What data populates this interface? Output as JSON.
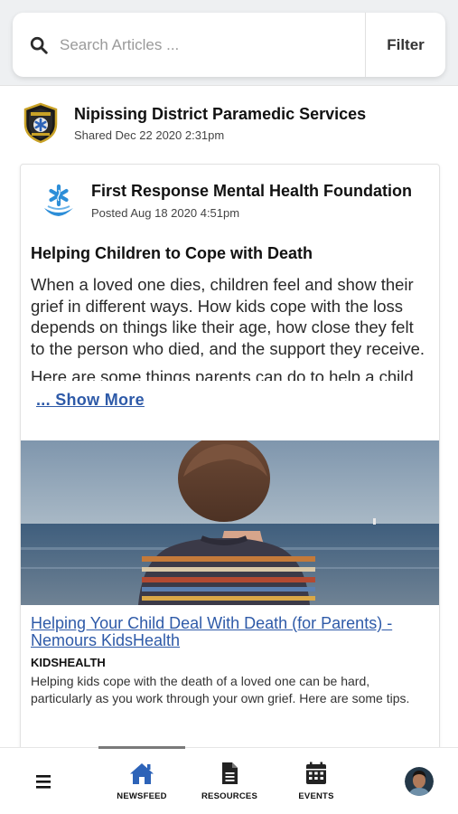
{
  "search": {
    "placeholder": "Search Articles ...",
    "filter_label": "Filter"
  },
  "share": {
    "org_name": "Nipissing District Paramedic Services",
    "shared_date": "Shared Dec 22 2020 2:31pm",
    "logo_icon": "paramedic-badge-icon"
  },
  "post": {
    "author": "First Response Mental Health Foundation",
    "posted_date": "Posted Aug 18 2020 4:51pm",
    "logo_icon": "star-of-life-icon",
    "title": "Helping Children to Cope with Death",
    "body_paragraphs": [
      "When a loved one dies, children feel and show their grief in different ways. How kids cope with the loss depends on things like their age, how close they felt to the person who died, and the support they receive.",
      "Here are some things parents can do to help a child deal with a loss:"
    ],
    "show_more": "... Show More"
  },
  "link_preview": {
    "title": "Helping Your Child Deal With Death (for Parents) - Nemours KidsHealth",
    "source": "KIDSHEALTH",
    "description": "Helping kids cope with the death of a loved one can be hard, particularly as you work through your own grief. Here are some tips.",
    "image_icon": "child-at-sea-photo"
  },
  "bottom_nav": {
    "menu_icon": "hamburger-menu-icon",
    "items": [
      {
        "label": "NEWSFEED",
        "icon": "home-icon",
        "active": true
      },
      {
        "label": "RESOURCES",
        "icon": "document-icon",
        "active": false
      },
      {
        "label": "EVENTS",
        "icon": "calendar-icon",
        "active": false
      }
    ],
    "avatar_icon": "user-avatar"
  },
  "colors": {
    "link": "#2e5aa8",
    "accent_blue": "#2d63b8",
    "background": "#eef0f2"
  }
}
